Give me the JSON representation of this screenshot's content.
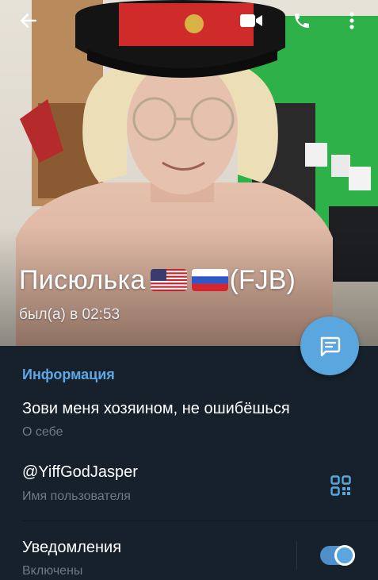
{
  "profile": {
    "name": "Писюлька",
    "name_suffix": "(FJB)",
    "flags": [
      "us-flag-icon",
      "ru-flag-icon"
    ],
    "last_seen": "был(а) в 02:53"
  },
  "toolbar": {
    "icons": [
      "back-arrow-icon",
      "video-call-icon",
      "phone-icon",
      "more-vertical-icon"
    ]
  },
  "info": {
    "section_title": "Информация",
    "bio": "Зови меня хозяином, не ошибёшься",
    "bio_label": "О себе",
    "username": "@YiffGodJasper",
    "username_label": "Имя пользователя",
    "notifications": "Уведомления",
    "notifications_status": "Включены",
    "notifications_enabled": true
  },
  "colors": {
    "accent": "#5aa7e0",
    "background": "#17212b",
    "section_title": "#5ea8e8",
    "secondary_text": "#6e7a87"
  }
}
